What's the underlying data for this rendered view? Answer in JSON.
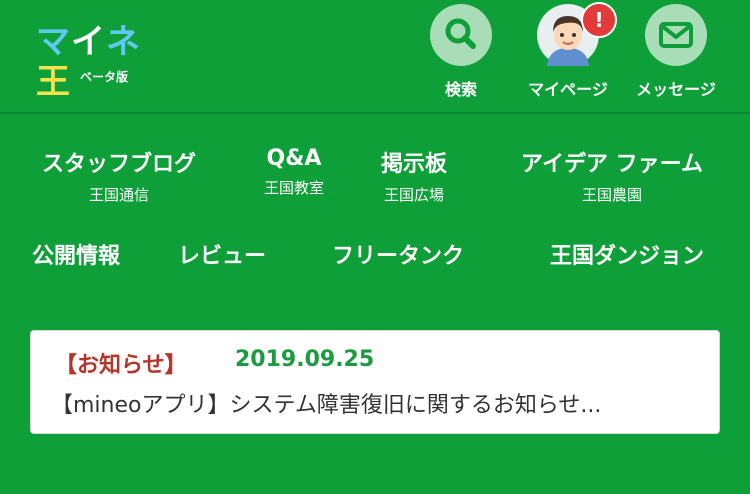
{
  "header": {
    "logo": "マイネ王",
    "logo_sub": "ベータ版",
    "buttons": [
      {
        "label": "検索",
        "icon": "search-icon"
      },
      {
        "label": "マイページ",
        "icon": "avatar",
        "badge": "!"
      },
      {
        "label": "メッセージ",
        "icon": "mail-icon"
      }
    ]
  },
  "nav": {
    "row1": [
      {
        "label": "スタッフブログ",
        "sub": "王国通信"
      },
      {
        "label": "Q&A",
        "sub": "王国教室"
      },
      {
        "label": "掲示板",
        "sub": "王国広場"
      },
      {
        "label": "アイデア ファーム",
        "sub": "王国農園"
      }
    ],
    "row2": [
      {
        "label": "公開情報"
      },
      {
        "label": "レビュー"
      },
      {
        "label": "フリータンク"
      },
      {
        "label": "王国ダンジョン"
      }
    ]
  },
  "news": {
    "tag": "【お知らせ】",
    "date": "2019.09.25",
    "title": "【mineoアプリ】システム障害復旧に関するお知らせ..."
  },
  "colors": {
    "background": "#0e9f39",
    "news_tag": "#b5352b",
    "news_date": "#1b9a3f",
    "badge": "#e23a3a"
  }
}
